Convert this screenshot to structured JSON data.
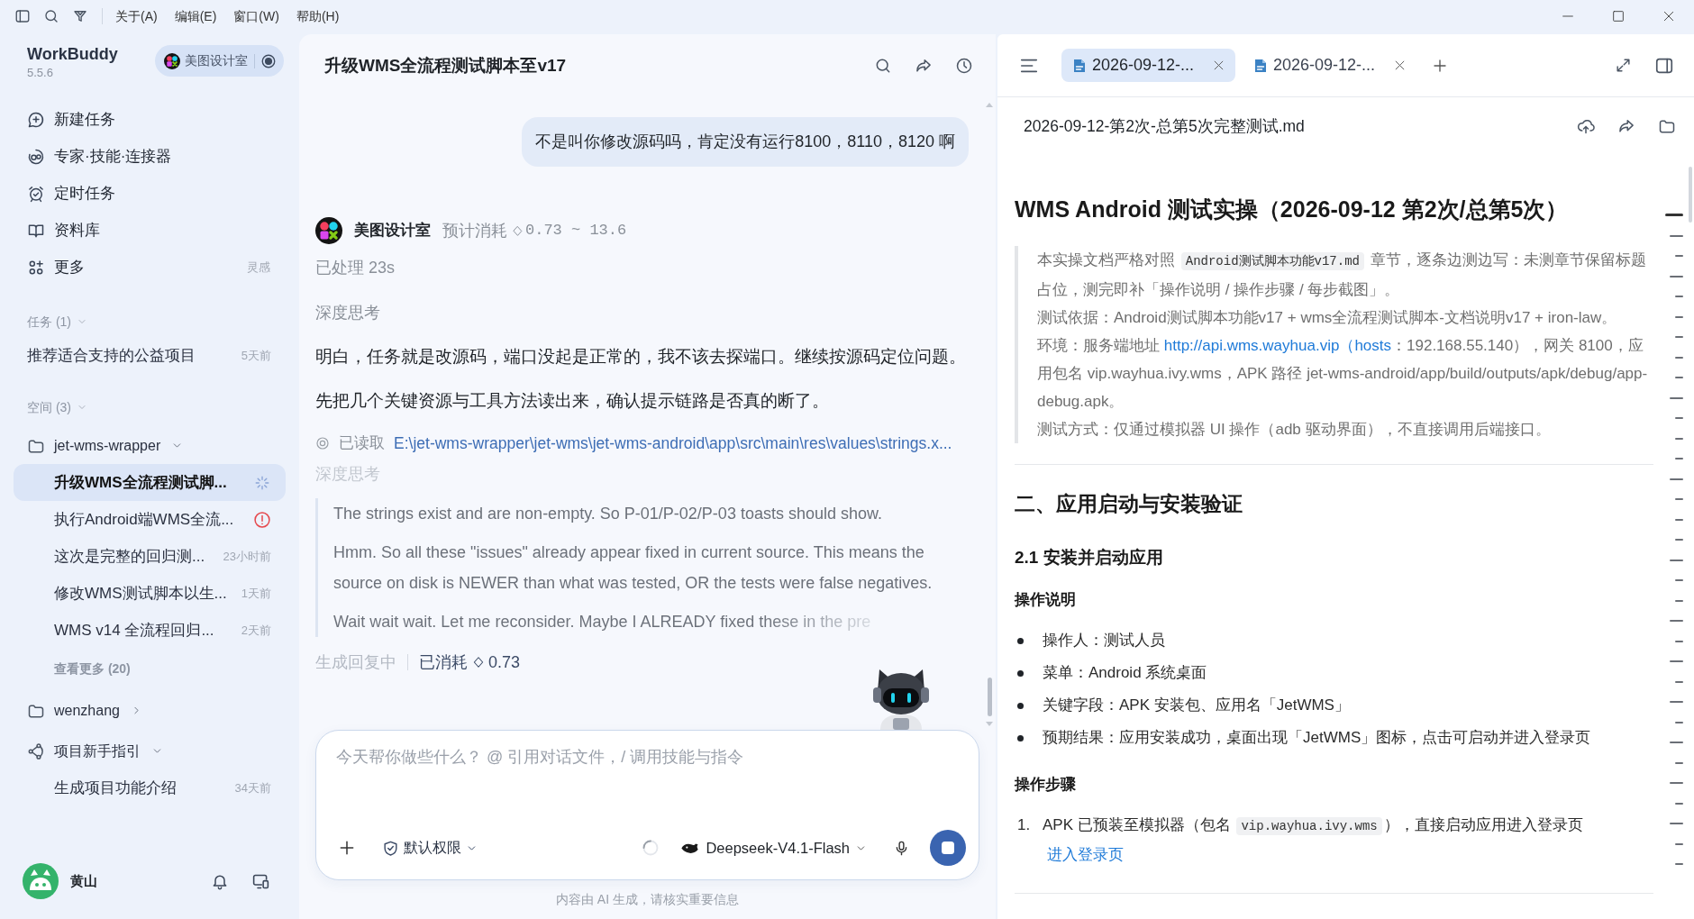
{
  "window": {
    "menu": [
      {
        "label": "关于(A)"
      },
      {
        "label": "编辑(E)"
      },
      {
        "label": "窗口(W)"
      },
      {
        "label": "帮助(H)"
      }
    ]
  },
  "sidebar": {
    "app_name": "WorkBuddy",
    "version": "5.5.6",
    "workspace": "美图设计室",
    "nav": [
      {
        "label": "新建任务"
      },
      {
        "label": "专家·技能·连接器"
      },
      {
        "label": "定时任务"
      },
      {
        "label": "资料库"
      },
      {
        "label": "更多",
        "hint": "灵感"
      }
    ],
    "sections": [
      {
        "title": "任务 (1)",
        "expanded": true,
        "items": [
          {
            "kind": "task",
            "title": "推荐适合支持的公益项目",
            "time": "5天前",
            "selected": false,
            "running": false,
            "failed": false
          }
        ]
      },
      {
        "title": "空间 (3)",
        "expanded": true,
        "items": [
          {
            "kind": "folder",
            "title": "jet-wms-wrapper",
            "expanded": true,
            "children": [
              {
                "kind": "task",
                "title": "升级WMS全流程测试脚...",
                "selected": true,
                "running": true,
                "failed": false
              },
              {
                "kind": "task",
                "title": "执行Android端WMS全流...",
                "selected": false,
                "running": false,
                "failed": true
              },
              {
                "kind": "task",
                "title": "这次是完整的回归测...",
                "time": "23小时前",
                "selected": false,
                "running": false,
                "failed": false
              },
              {
                "kind": "task",
                "title": "修改WMS测试脚本以生...",
                "time": "1天前",
                "selected": false,
                "running": false,
                "failed": false
              },
              {
                "kind": "task",
                "title": "WMS v14 全流程回归...",
                "time": "2天前",
                "selected": false,
                "running": false,
                "failed": false
              },
              {
                "kind": "more",
                "title": "查看更多 (20)"
              }
            ]
          },
          {
            "kind": "folder",
            "title": "wenzhang",
            "expanded": false
          },
          {
            "kind": "project",
            "title": "项目新手指引",
            "expanded": true,
            "children": [
              {
                "kind": "task",
                "title": "生成项目功能介绍",
                "time": "34天前",
                "selected": false,
                "running": false,
                "failed": false
              }
            ]
          }
        ]
      }
    ],
    "user": {
      "name": "黄山"
    }
  },
  "chat": {
    "title": "升级WMS全流程测试脚本至v17",
    "messages": [
      {
        "kind": "user",
        "text": "不是叫你修改源码吗，肯定没有运行8100，8110，8120 啊"
      },
      {
        "kind": "assistant",
        "author": "美图设计室",
        "estimate_label": "预计消耗",
        "estimate": "0.73 ~ 13.6",
        "elapsed": "已处理 23s",
        "blocks": [
          {
            "kind": "thinking",
            "text": "深度思考",
            "faded": false
          },
          {
            "kind": "paragraph",
            "text": "明白，任务就是改源码，端口没起是正常的，我不该去探端口。继续按源码定位问题。"
          },
          {
            "kind": "paragraph",
            "text": "先把几个关键资源与工具方法读出来，确认提示链路是否真的断了。"
          },
          {
            "kind": "file_read",
            "label": "已读取",
            "path": "E:\\jet-wms-wrapper\\jet-wms\\jet-wms-android\\app\\src\\main\\res\\values\\strings.x..."
          },
          {
            "kind": "thinking",
            "text": "深度思考",
            "faded": true
          },
          {
            "kind": "thought",
            "paragraphs": [
              "The strings exist and are non-empty. So P-01/P-02/P-03 toasts should show.",
              "Hmm. So all these \"issues\" already appear fixed in current source. This means the source on disk is NEWER than what was tested, OR the tests were false negatives.",
              "Wait wait wait. Let me reconsider. Maybe I ALREADY fixed these in the pre"
            ],
            "streaming": true
          }
        ]
      }
    ],
    "status": {
      "state": "生成回复中",
      "spent_label": "已消耗",
      "spent": "0.73"
    },
    "composer": {
      "placeholder": "今天帮你做些什么？ @ 引用对话文件，/ 调用技能与指令",
      "permission": "默认权限",
      "model": "Deepseek-V4.1-Flash",
      "generating": true
    },
    "disclaimer": "内容由 AI 生成，请核实重要信息"
  },
  "document": {
    "tabs": [
      {
        "label": "2026-09-12-...",
        "selected": true
      },
      {
        "label": "2026-09-12-...",
        "selected": false
      }
    ],
    "file_name": "2026-09-12-第2次-总第5次完整测试.md",
    "content": [
      {
        "kind": "h1",
        "text": "WMS Android 测试实操（2026-09-12 第2次/总第5次）"
      },
      {
        "kind": "quote",
        "paragraphs": [
          [
            {
              "kind": "text",
              "text": "本实操文档严格对照 "
            },
            {
              "kind": "code",
              "text": "Android测试脚本功能v17.md"
            },
            {
              "kind": "text",
              "text": " 章节，逐条边测边写：未测章节保留标题占位，测完即补「操作说明 / 操作步骤 / 每步截图」。"
            }
          ],
          [
            {
              "kind": "text",
              "text": "测试依据：Android测试脚本功能v17 + wms全流程测试脚本-文档说明v17 + iron-law。"
            }
          ],
          [
            {
              "kind": "text",
              "text": "环境：服务端地址 "
            },
            {
              "kind": "link",
              "text": "http://api.wms.wayhua.vip（hosts"
            },
            {
              "kind": "text",
              "text": "：192.168.55.140），网关 8100，应用包名 vip.wayhua.ivy.wms，APK 路径 jet-wms-android/app/build/outputs/apk/debug/app-debug.apk。"
            }
          ],
          [
            {
              "kind": "text",
              "text": "测试方式：仅通过模拟器 UI 操作（adb 驱动界面），不直接调用后端接口。"
            }
          ]
        ]
      },
      {
        "kind": "hr"
      },
      {
        "kind": "h2",
        "text": "二、应用启动与安装验证"
      },
      {
        "kind": "h3",
        "text": "2.1 安装并启动应用"
      },
      {
        "kind": "h4",
        "text": "操作说明"
      },
      {
        "kind": "bullets",
        "items": [
          "操作人：测试人员",
          "菜单：Android 系统桌面",
          "关键字段：APK 安装包、应用名「JetWMS」",
          "预期结果：应用安装成功，桌面出现「JetWMS」图标，点击可启动并进入登录页"
        ]
      },
      {
        "kind": "h4",
        "text": "操作步骤"
      },
      {
        "kind": "steps",
        "items": [
          {
            "number": "1.",
            "parts": [
              {
                "kind": "text",
                "text": "APK 已预装至模拟器（包名 "
              },
              {
                "kind": "code",
                "text": "vip.wayhua.ivy.wms"
              },
              {
                "kind": "text",
                "text": "），直接启动应用进入登录页"
              }
            ],
            "link": "进入登录页"
          }
        ]
      },
      {
        "kind": "hr"
      }
    ]
  }
}
